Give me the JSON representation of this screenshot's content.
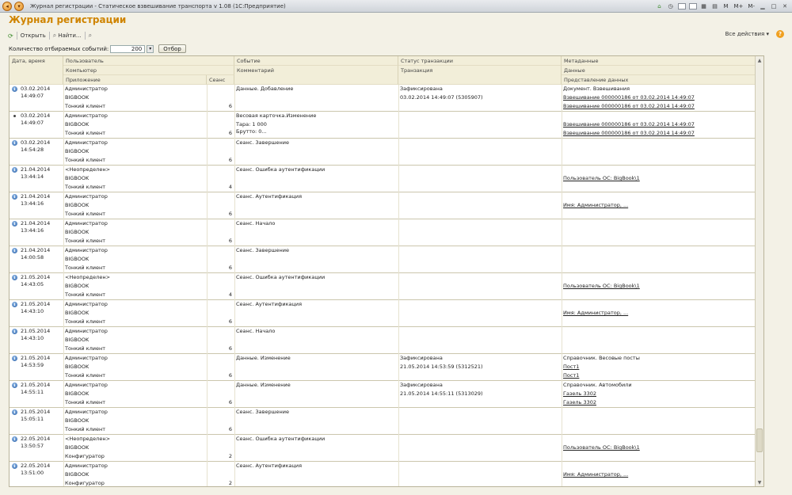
{
  "window": {
    "title": "Журнал регистрации - Статическое взвешивание транспорта v 1.08  (1С:Предприятие)",
    "right_icons": [
      "M",
      "M+",
      "M-"
    ]
  },
  "form": {
    "title": "Журнал регистрации"
  },
  "toolbar": {
    "open_label": "Открыть",
    "find_label": "Найти...",
    "all_actions_label": "Все действия ▾",
    "help_label": "?"
  },
  "filter": {
    "count_label": "Количество отбираемых событий:",
    "count_value": "200",
    "select_button": "Отбор"
  },
  "columns": {
    "date": "Дата, время",
    "user": "Пользователь",
    "computer": "Компьютер",
    "application": "Приложение",
    "session": "Сеанс",
    "event": "Событие",
    "comment": "Комментарий",
    "status": "Статус транзакции",
    "transaction": "Транзакция",
    "metadata": "Метаданные",
    "data": "Данные",
    "data_repr": "Представление данных"
  },
  "rows": [
    {
      "icon": "info",
      "date": "03.02.2014",
      "time": "14:49:07",
      "user": "Администратор",
      "computer": "BIGBOOK",
      "app": "Тонкий клиент",
      "session": "6",
      "event": "Данные. Добавление",
      "comment": "",
      "comment2": "",
      "status": "Зафиксирована",
      "transaction": "03.02.2014 14:49:07 (5305907)",
      "metadata": "Документ. Взвешивания",
      "data": "Взвешивание 000000186 от 03.02.2014 14:49:07",
      "repr": "Взвешивание 000000186 от 03.02.2014 14:49:07"
    },
    {
      "icon": "dot",
      "date": "03.02.2014",
      "time": "14:49:07",
      "user": "Администратор",
      "computer": "BIGBOOK",
      "app": "Тонкий клиент",
      "session": "6",
      "event": "Весовая карточка.Изменение",
      "comment": "Тара: 1 000",
      "comment2": "Брутто: 0...",
      "status": "",
      "transaction": "",
      "metadata": "",
      "data": "Взвешивание 000000186 от 03.02.2014 14:49:07",
      "repr": "Взвешивание 000000186 от 03.02.2014 14:49:07"
    },
    {
      "icon": "info",
      "date": "03.02.2014",
      "time": "14:54:28",
      "user": "Администратор",
      "computer": "BIGBOOK",
      "app": "Тонкий клиент",
      "session": "6",
      "event": "Сеанс. Завершение",
      "comment": "",
      "comment2": "",
      "status": "",
      "transaction": "",
      "metadata": "",
      "data": "",
      "repr": ""
    },
    {
      "icon": "info",
      "date": "21.04.2014",
      "time": "13:44:14",
      "user": "<Неопределен>",
      "computer": "BIGBOOK",
      "app": "Тонкий клиент",
      "session": "4",
      "event": "Сеанс. Ошибка аутентификации",
      "comment": "",
      "comment2": "",
      "status": "",
      "transaction": "",
      "metadata": "",
      "data": "Пользователь ОС: BigBook\\1",
      "repr": ""
    },
    {
      "icon": "info",
      "date": "21.04.2014",
      "time": "13:44:16",
      "user": "Администратор",
      "computer": "BIGBOOK",
      "app": "Тонкий клиент",
      "session": "6",
      "event": "Сеанс. Аутентификация",
      "comment": "",
      "comment2": "",
      "status": "",
      "transaction": "",
      "metadata": "",
      "data": "Имя: Администратор, ...",
      "repr": ""
    },
    {
      "icon": "info",
      "date": "21.04.2014",
      "time": "13:44:16",
      "user": "Администратор",
      "computer": "BIGBOOK",
      "app": "Тонкий клиент",
      "session": "6",
      "event": "Сеанс. Начало",
      "comment": "",
      "comment2": "",
      "status": "",
      "transaction": "",
      "metadata": "",
      "data": "",
      "repr": ""
    },
    {
      "icon": "info",
      "date": "21.04.2014",
      "time": "14:00:58",
      "user": "Администратор",
      "computer": "BIGBOOK",
      "app": "Тонкий клиент",
      "session": "6",
      "event": "Сеанс. Завершение",
      "comment": "",
      "comment2": "",
      "status": "",
      "transaction": "",
      "metadata": "",
      "data": "",
      "repr": ""
    },
    {
      "icon": "info",
      "date": "21.05.2014",
      "time": "14:43:05",
      "user": "<Неопределен>",
      "computer": "BIGBOOK",
      "app": "Тонкий клиент",
      "session": "4",
      "event": "Сеанс. Ошибка аутентификации",
      "comment": "",
      "comment2": "",
      "status": "",
      "transaction": "",
      "metadata": "",
      "data": "Пользователь ОС: BigBook\\1",
      "repr": ""
    },
    {
      "icon": "info",
      "date": "21.05.2014",
      "time": "14:43:10",
      "user": "Администратор",
      "computer": "BIGBOOK",
      "app": "Тонкий клиент",
      "session": "6",
      "event": "Сеанс. Аутентификация",
      "comment": "",
      "comment2": "",
      "status": "",
      "transaction": "",
      "metadata": "",
      "data": "Имя: Администратор, ...",
      "repr": ""
    },
    {
      "icon": "info",
      "date": "21.05.2014",
      "time": "14:43:10",
      "user": "Администратор",
      "computer": "BIGBOOK",
      "app": "Тонкий клиент",
      "session": "6",
      "event": "Сеанс. Начало",
      "comment": "",
      "comment2": "",
      "status": "",
      "transaction": "",
      "metadata": "",
      "data": "",
      "repr": ""
    },
    {
      "icon": "info",
      "date": "21.05.2014",
      "time": "14:53:59",
      "user": "Администратор",
      "computer": "BIGBOOK",
      "app": "Тонкий клиент",
      "session": "6",
      "event": "Данные. Изменение",
      "comment": "",
      "comment2": "",
      "status": "Зафиксирована",
      "transaction": "21.05.2014 14:53:59 (5312521)",
      "metadata": "Справочник. Весовые посты",
      "data": "Пост1",
      "repr": "Пост1"
    },
    {
      "icon": "info",
      "date": "21.05.2014",
      "time": "14:55:11",
      "user": "Администратор",
      "computer": "BIGBOOK",
      "app": "Тонкий клиент",
      "session": "6",
      "event": "Данные. Изменение",
      "comment": "",
      "comment2": "",
      "status": "Зафиксирована",
      "transaction": "21.05.2014 14:55:11 (5313029)",
      "metadata": "Справочник. Автомобили",
      "data": "Газель 3302",
      "repr": "Газель 3302"
    },
    {
      "icon": "info",
      "date": "21.05.2014",
      "time": "15:05:11",
      "user": "Администратор",
      "computer": "BIGBOOK",
      "app": "Тонкий клиент",
      "session": "6",
      "event": "Сеанс. Завершение",
      "comment": "",
      "comment2": "",
      "status": "",
      "transaction": "",
      "metadata": "",
      "data": "",
      "repr": ""
    },
    {
      "icon": "info",
      "date": "22.05.2014",
      "time": "13:50:57",
      "user": "<Неопределен>",
      "computer": "BIGBOOK",
      "app": "Конфигуратор",
      "session": "2",
      "event": "Сеанс. Ошибка аутентификации",
      "comment": "",
      "comment2": "",
      "status": "",
      "transaction": "",
      "metadata": "",
      "data": "Пользователь ОС: BigBook\\1",
      "repr": ""
    },
    {
      "icon": "info",
      "date": "22.05.2014",
      "time": "13:51:00",
      "user": "Администратор",
      "computer": "BIGBOOK",
      "app": "Конфигуратор",
      "session": "2",
      "event": "Сеанс. Аутентификация",
      "comment": "",
      "comment2": "",
      "status": "",
      "transaction": "",
      "metadata": "",
      "data": "Имя: Администратор, ...",
      "repr": ""
    }
  ]
}
